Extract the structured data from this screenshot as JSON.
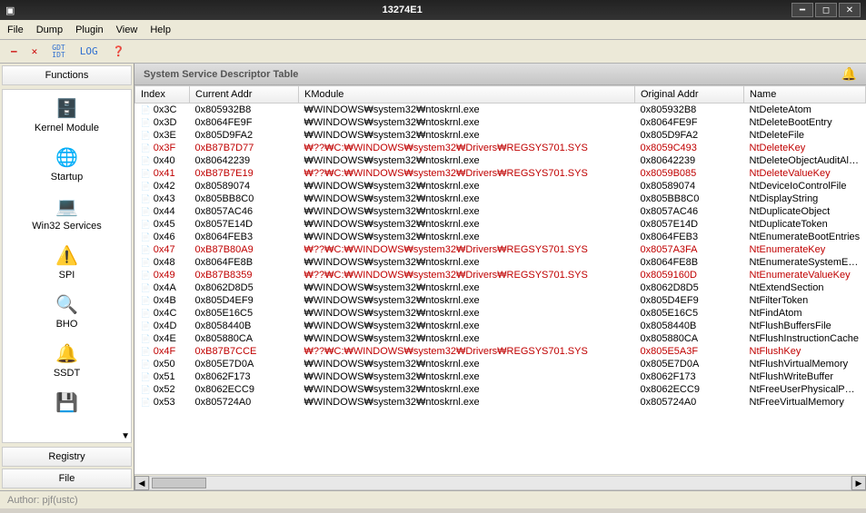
{
  "title": "13274E1",
  "menu": [
    "File",
    "Dump",
    "Plugin",
    "View",
    "Help"
  ],
  "toolbar": {
    "minus": "—",
    "x": "✕",
    "gdt": "GDT\nIDT",
    "log": "LOG",
    "bang": "❓"
  },
  "sidebar": {
    "header": "Functions",
    "items": [
      {
        "icon": "🗄️",
        "label": "Kernel Module"
      },
      {
        "icon": "🌐",
        "label": "Startup"
      },
      {
        "icon": "💻",
        "label": "Win32 Services"
      },
      {
        "icon": "⚠️",
        "label": "SPI"
      },
      {
        "icon": "🔍",
        "label": "BHO"
      },
      {
        "icon": "🔔",
        "label": "SSDT"
      },
      {
        "icon": "💾",
        "label": ""
      }
    ],
    "footer": [
      "Registry",
      "File"
    ]
  },
  "content_header": "System Service Descriptor Table",
  "columns": [
    "Index",
    "Current Addr",
    "KModule",
    "Original Addr",
    "Name"
  ],
  "rows": [
    {
      "r": false,
      "c": [
        "0x3C",
        "0x805932B8",
        "₩WINDOWS₩system32₩ntoskrnl.exe",
        "0x805932B8",
        "NtDeleteAtom"
      ]
    },
    {
      "r": false,
      "c": [
        "0x3D",
        "0x8064FE9F",
        "₩WINDOWS₩system32₩ntoskrnl.exe",
        "0x8064FE9F",
        "NtDeleteBootEntry"
      ]
    },
    {
      "r": false,
      "c": [
        "0x3E",
        "0x805D9FA2",
        "₩WINDOWS₩system32₩ntoskrnl.exe",
        "0x805D9FA2",
        "NtDeleteFile"
      ]
    },
    {
      "r": true,
      "c": [
        "0x3F",
        "0xB87B7D77",
        "₩??₩C:₩WINDOWS₩system32₩Drivers₩REGSYS701.SYS",
        "0x8059C493",
        "NtDeleteKey"
      ]
    },
    {
      "r": false,
      "c": [
        "0x40",
        "0x80642239",
        "₩WINDOWS₩system32₩ntoskrnl.exe",
        "0x80642239",
        "NtDeleteObjectAuditAlarm"
      ]
    },
    {
      "r": true,
      "c": [
        "0x41",
        "0xB87B7E19",
        "₩??₩C:₩WINDOWS₩system32₩Drivers₩REGSYS701.SYS",
        "0x8059B085",
        "NtDeleteValueKey"
      ]
    },
    {
      "r": false,
      "c": [
        "0x42",
        "0x80589074",
        "₩WINDOWS₩system32₩ntoskrnl.exe",
        "0x80589074",
        "NtDeviceIoControlFile"
      ]
    },
    {
      "r": false,
      "c": [
        "0x43",
        "0x805BB8C0",
        "₩WINDOWS₩system32₩ntoskrnl.exe",
        "0x805BB8C0",
        "NtDisplayString"
      ]
    },
    {
      "r": false,
      "c": [
        "0x44",
        "0x8057AC46",
        "₩WINDOWS₩system32₩ntoskrnl.exe",
        "0x8057AC46",
        "NtDuplicateObject"
      ]
    },
    {
      "r": false,
      "c": [
        "0x45",
        "0x8057E14D",
        "₩WINDOWS₩system32₩ntoskrnl.exe",
        "0x8057E14D",
        "NtDuplicateToken"
      ]
    },
    {
      "r": false,
      "c": [
        "0x46",
        "0x8064FEB3",
        "₩WINDOWS₩system32₩ntoskrnl.exe",
        "0x8064FEB3",
        "NtEnumerateBootEntries"
      ]
    },
    {
      "r": true,
      "c": [
        "0x47",
        "0xB87B80A9",
        "₩??₩C:₩WINDOWS₩system32₩Drivers₩REGSYS701.SYS",
        "0x8057A3FA",
        "NtEnumerateKey"
      ]
    },
    {
      "r": false,
      "c": [
        "0x48",
        "0x8064FE8B",
        "₩WINDOWS₩system32₩ntoskrnl.exe",
        "0x8064FE8B",
        "NtEnumerateSystemEnvir"
      ]
    },
    {
      "r": true,
      "c": [
        "0x49",
        "0xB87B8359",
        "₩??₩C:₩WINDOWS₩system32₩Drivers₩REGSYS701.SYS",
        "0x8059160D",
        "NtEnumerateValueKey"
      ]
    },
    {
      "r": false,
      "c": [
        "0x4A",
        "0x8062D8D5",
        "₩WINDOWS₩system32₩ntoskrnl.exe",
        "0x8062D8D5",
        "NtExtendSection"
      ]
    },
    {
      "r": false,
      "c": [
        "0x4B",
        "0x805D4EF9",
        "₩WINDOWS₩system32₩ntoskrnl.exe",
        "0x805D4EF9",
        "NtFilterToken"
      ]
    },
    {
      "r": false,
      "c": [
        "0x4C",
        "0x805E16C5",
        "₩WINDOWS₩system32₩ntoskrnl.exe",
        "0x805E16C5",
        "NtFindAtom"
      ]
    },
    {
      "r": false,
      "c": [
        "0x4D",
        "0x8058440B",
        "₩WINDOWS₩system32₩ntoskrnl.exe",
        "0x8058440B",
        "NtFlushBuffersFile"
      ]
    },
    {
      "r": false,
      "c": [
        "0x4E",
        "0x805880CA",
        "₩WINDOWS₩system32₩ntoskrnl.exe",
        "0x805880CA",
        "NtFlushInstructionCache"
      ]
    },
    {
      "r": true,
      "c": [
        "0x4F",
        "0xB87B7CCE",
        "₩??₩C:₩WINDOWS₩system32₩Drivers₩REGSYS701.SYS",
        "0x805E5A3F",
        "NtFlushKey"
      ]
    },
    {
      "r": false,
      "c": [
        "0x50",
        "0x805E7D0A",
        "₩WINDOWS₩system32₩ntoskrnl.exe",
        "0x805E7D0A",
        "NtFlushVirtualMemory"
      ]
    },
    {
      "r": false,
      "c": [
        "0x51",
        "0x8062F173",
        "₩WINDOWS₩system32₩ntoskrnl.exe",
        "0x8062F173",
        "NtFlushWriteBuffer"
      ]
    },
    {
      "r": false,
      "c": [
        "0x52",
        "0x8062ECC9",
        "₩WINDOWS₩system32₩ntoskrnl.exe",
        "0x8062ECC9",
        "NtFreeUserPhysicalPages"
      ]
    },
    {
      "r": false,
      "c": [
        "0x53",
        "0x805724A0",
        "₩WINDOWS₩system32₩ntoskrnl.exe",
        "0x805724A0",
        "NtFreeVirtualMemory"
      ]
    }
  ],
  "status": "Author: pjf(ustc)"
}
